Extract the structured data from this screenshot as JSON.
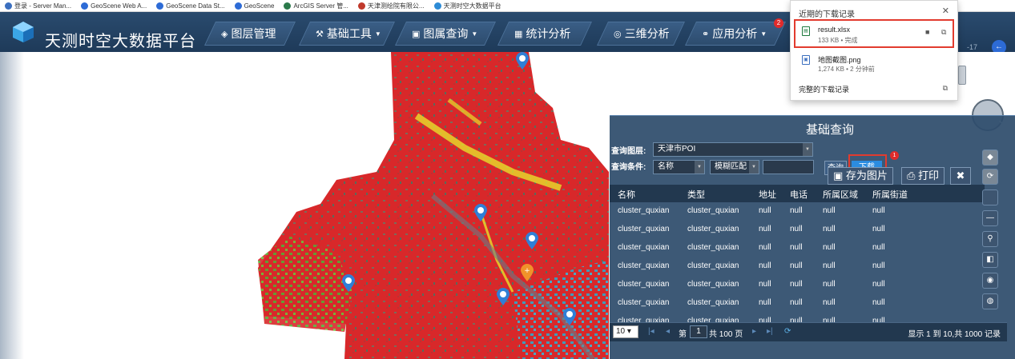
{
  "bookmarks": [
    {
      "label": "登录 - Server Man...",
      "icon": "server-icon",
      "color": "#3b6fbf"
    },
    {
      "label": "GeoScene Web A...",
      "icon": "g-icon",
      "color": "#2d6bd6"
    },
    {
      "label": "GeoScene Data St...",
      "icon": "g-icon",
      "color": "#2d6bd6"
    },
    {
      "label": "GeoScene",
      "icon": "g-icon",
      "color": "#2d6bd6"
    },
    {
      "label": "ArcGIS Server 管...",
      "icon": "arcgis-icon",
      "color": "#2b7a4b"
    },
    {
      "label": "天津测绘院有限公...",
      "icon": "tj-icon",
      "color": "#c0392b"
    },
    {
      "label": "天测时空大数据平台",
      "icon": "globe-icon",
      "color": "#2d8bd6"
    }
  ],
  "header": {
    "title": "天测时空大数据平台",
    "nav": [
      {
        "label": "图层管理",
        "icon": "layers-icon",
        "dropdown": false
      },
      {
        "label": "基础工具",
        "icon": "tools-icon",
        "dropdown": true
      },
      {
        "label": "图属查询",
        "icon": "query-icon",
        "dropdown": true
      },
      {
        "label": "统计分析",
        "icon": "stats-icon",
        "dropdown": false
      },
      {
        "label": "三维分析",
        "icon": "3d-icon",
        "dropdown": false
      },
      {
        "label": "应用分析",
        "icon": "apps-icon",
        "dropdown": true,
        "badge": "2"
      }
    ],
    "date_fragment": "-17"
  },
  "downloads": {
    "title": "近期的下载记录",
    "items": [
      {
        "name": "result.xlsx",
        "meta": "133 KB • 完成",
        "icon": "excel-file-icon"
      },
      {
        "name": "地图截图.png",
        "meta": "1,274 KB • 2 分钟前",
        "icon": "image-file-icon"
      }
    ],
    "all_link": "完整的下载记录"
  },
  "query": {
    "title": "基础查询",
    "layer_label": "查询图层:",
    "layer_value": "天津市POI",
    "cond_label": "查询条件:",
    "field_value": "名称",
    "mode_value": "模糊匹配",
    "input_value": "",
    "query_btn": "查询",
    "download_btn": "下载",
    "download_badge": "1",
    "save_img_btn": "存为图片",
    "print_btn": "打印",
    "close_btn": "✖",
    "columns": [
      "名称",
      "类型",
      "地址",
      "电话",
      "所属区域",
      "所属街道"
    ],
    "rows": [
      [
        "cluster_quxian",
        "cluster_quxian",
        "null",
        "null",
        "null",
        "null"
      ],
      [
        "cluster_quxian",
        "cluster_quxian",
        "null",
        "null",
        "null",
        "null"
      ],
      [
        "cluster_quxian",
        "cluster_quxian",
        "null",
        "null",
        "null",
        "null"
      ],
      [
        "cluster_quxian",
        "cluster_quxian",
        "null",
        "null",
        "null",
        "null"
      ],
      [
        "cluster_quxian",
        "cluster_quxian",
        "null",
        "null",
        "null",
        "null"
      ],
      [
        "cluster_quxian",
        "cluster_quxian",
        "null",
        "null",
        "null",
        "null"
      ],
      [
        "cluster_quxian",
        "cluster_quxian",
        "null",
        "null",
        "null",
        "null"
      ]
    ],
    "pager": {
      "page_size": "10",
      "page_prefix": "第",
      "page_num": "1",
      "page_suffix": "共 100 页",
      "summary": "显示 1 到 10,共 1000 记录"
    }
  },
  "colors": {
    "nav_bg": "#1e3a59",
    "panel_bg": "#2e4c6c",
    "highlight": "#e23b2e",
    "map_red": "#d8282a",
    "map_green": "#5aa832",
    "map_yellow": "#e8e02a",
    "map_cyan": "#2fa7c9",
    "marker_blue": "#2f7fd6",
    "marker_orange": "#f0922a"
  }
}
